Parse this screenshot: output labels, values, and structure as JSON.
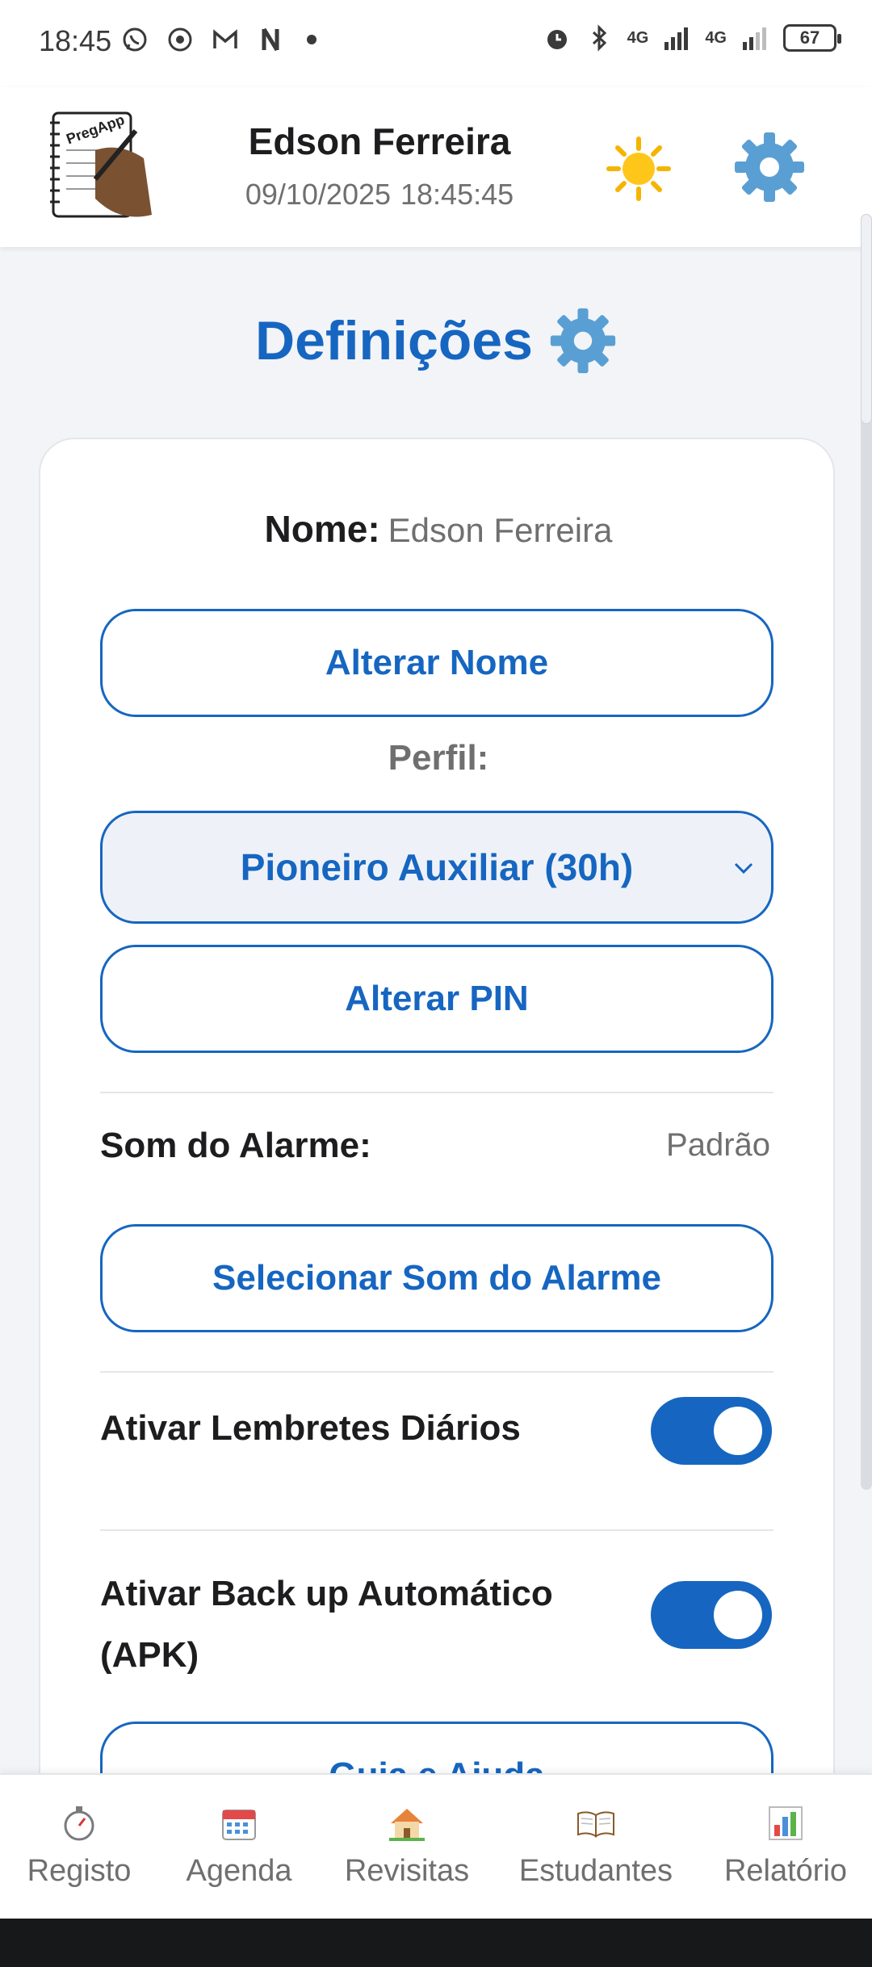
{
  "status_bar": {
    "time": "18:45",
    "battery": "67",
    "signal1": "4G",
    "signal2": "4G"
  },
  "header": {
    "logo_text": "PregApp",
    "user_name": "Edson Ferreira",
    "date": "09/10/2025",
    "time": "18:45:45"
  },
  "page": {
    "title": "Definições"
  },
  "settings": {
    "name_label": "Nome:",
    "name_value": "Edson Ferreira",
    "change_name_label": "Alterar Nome",
    "profile_label": "Perfil:",
    "profile_selected": "Pioneiro Auxiliar (30h)",
    "change_pin_label": "Alterar PIN",
    "alarm_sound_label": "Som do Alarme:",
    "alarm_sound_value": "Padrão",
    "select_alarm_label": "Selecionar Som do Alarme",
    "daily_reminders_label": "Ativar Lembretes Diários",
    "daily_reminders_on": true,
    "auto_backup_label_line1": "Ativar Back up Automático",
    "auto_backup_label_line2": "(APK)",
    "auto_backup_on": true,
    "help_label": "Guia e Ajuda"
  },
  "nav": {
    "items": [
      {
        "label": "Registo",
        "icon": "stopwatch-icon"
      },
      {
        "label": "Agenda",
        "icon": "calendar-icon"
      },
      {
        "label": "Revisitas",
        "icon": "house-icon"
      },
      {
        "label": "Estudantes",
        "icon": "book-icon"
      },
      {
        "label": "Relatório",
        "icon": "chart-icon"
      }
    ]
  },
  "colors": {
    "accent": "#1666c1",
    "muted": "#6f6f6f",
    "background": "#f2f4f7"
  }
}
